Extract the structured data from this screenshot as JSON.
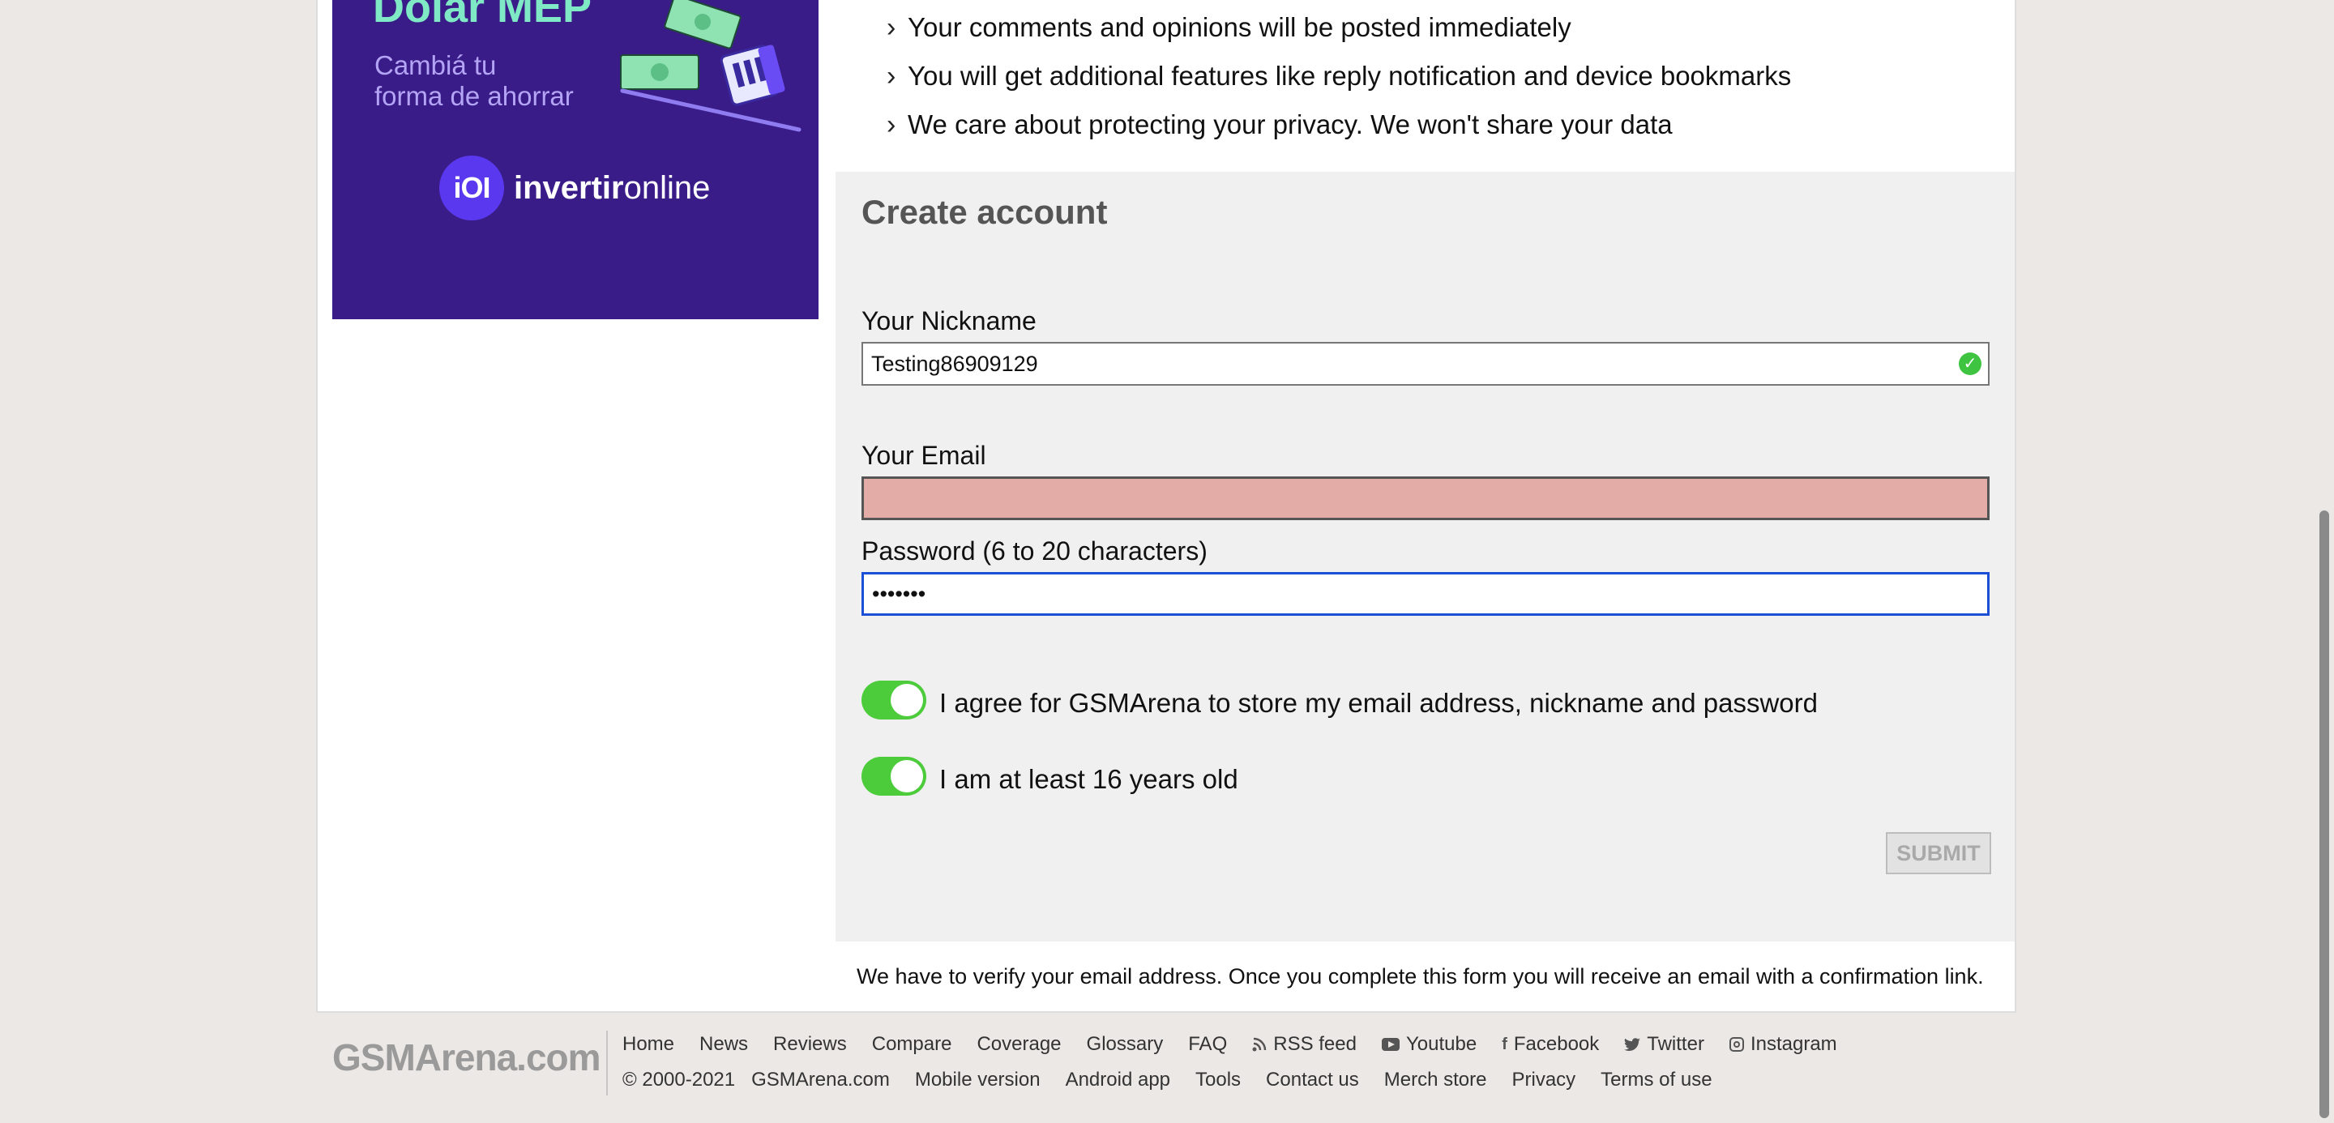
{
  "ad": {
    "headline": "Dolar MEP",
    "subtitle_line1": "Cambiá tu",
    "subtitle_line2": "forma de ahorrar",
    "logo_mark": "iOI",
    "logo_bold": "invertir",
    "logo_light": "online"
  },
  "benefits": [
    "Your comments and opinions will be posted immediately",
    "You will get additional features like reply notification and device bookmarks",
    "We care about protecting your privacy. We won't share your data"
  ],
  "form": {
    "title": "Create account",
    "nickname_label": "Your Nickname",
    "nickname_value": "Testing86909129",
    "email_label": "Your Email",
    "email_value": "",
    "password_label": "Password (6 to 20 characters)",
    "password_value": "•••••••",
    "agree_label": "I agree for GSMArena to store my email address, nickname and password",
    "age_label": "I am at least 16 years old",
    "agree_checked": true,
    "age_checked": true,
    "submit_label": "SUBMIT"
  },
  "verify_note": "We have to verify your email address. Once you complete this form you will receive an email with a confirmation link.",
  "footer": {
    "logo": "GSMArena.com",
    "row1": [
      "Home",
      "News",
      "Reviews",
      "Compare",
      "Coverage",
      "Glossary",
      "FAQ",
      "RSS feed",
      "Youtube",
      "Facebook",
      "Twitter",
      "Instagram"
    ],
    "row2": [
      "© 2000-2021",
      "GSMArena.com",
      "Mobile version",
      "Android app",
      "Tools",
      "Contact us",
      "Merch store",
      "Privacy",
      "Terms of use"
    ]
  },
  "colors": {
    "ad_background": "#3a1c88",
    "toggle_on": "#4ccb3b",
    "email_error": "#e4aca7",
    "focus_border": "#1b4fd6",
    "valid_check": "#3fc442"
  }
}
